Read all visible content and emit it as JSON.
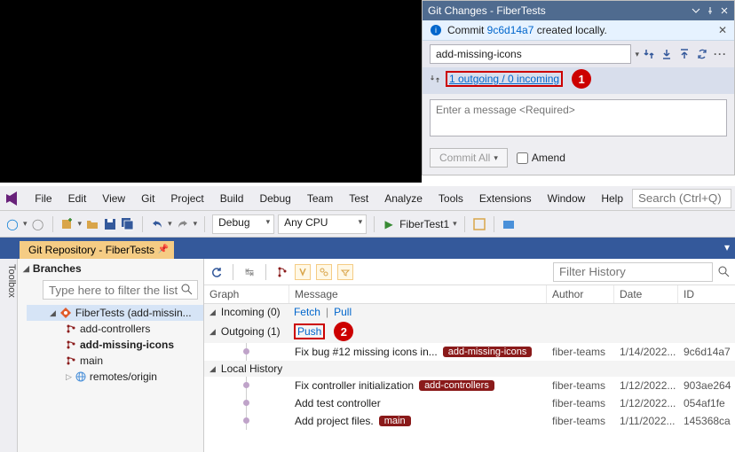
{
  "git_panel": {
    "title": "Git Changes - FiberTests",
    "notice_prefix": "Commit ",
    "notice_hash": "9c6d14a7",
    "notice_suffix": " created locally.",
    "branch": "add-missing-icons",
    "sync_status": "1 outgoing / 0 incoming",
    "callout_1": "1",
    "message_placeholder": "Enter a message <Required>",
    "commit_button": "Commit All",
    "amend_label": "Amend"
  },
  "menubar": {
    "items": [
      "File",
      "Edit",
      "View",
      "Git",
      "Project",
      "Build",
      "Debug",
      "Team",
      "Test",
      "Analyze",
      "Tools",
      "Extensions",
      "Window",
      "Help"
    ],
    "search_placeholder": "Search (Ctrl+Q)"
  },
  "toolbar": {
    "config": "Debug",
    "platform": "Any CPU",
    "start_target": "FiberTest1"
  },
  "tab": {
    "label": "Git Repository - FiberTests"
  },
  "side": {
    "toolbox": "Toolbox"
  },
  "branches": {
    "header": "Branches",
    "filter_placeholder": "Type here to filter the list",
    "repo": "FiberTests (add-missin...",
    "items": [
      "add-controllers",
      "add-missing-icons",
      "main",
      "remotes/origin"
    ]
  },
  "history": {
    "filter_placeholder": "Filter History",
    "columns": {
      "graph": "Graph",
      "message": "Message",
      "author": "Author",
      "date": "Date",
      "id": "ID"
    },
    "incoming_label": "Incoming (0)",
    "fetch": "Fetch",
    "pull": "Pull",
    "outgoing_label": "Outgoing (1)",
    "push": "Push",
    "callout_2": "2",
    "local_history": "Local History",
    "rows": [
      {
        "message": "Fix bug #12 missing icons in...",
        "tag": "add-missing-icons",
        "author": "fiber-teams",
        "date": "1/14/2022...",
        "id": "9c6d14a7"
      },
      {
        "message": "Fix controller initialization",
        "tag": "add-controllers",
        "author": "fiber-teams",
        "date": "1/12/2022...",
        "id": "903ae264"
      },
      {
        "message": "Add test controller",
        "tag": "",
        "author": "fiber-teams",
        "date": "1/12/2022...",
        "id": "054af1fe"
      },
      {
        "message": "Add project files.",
        "tag": "main",
        "author": "fiber-teams",
        "date": "1/11/2022...",
        "id": "145368ca"
      }
    ]
  }
}
